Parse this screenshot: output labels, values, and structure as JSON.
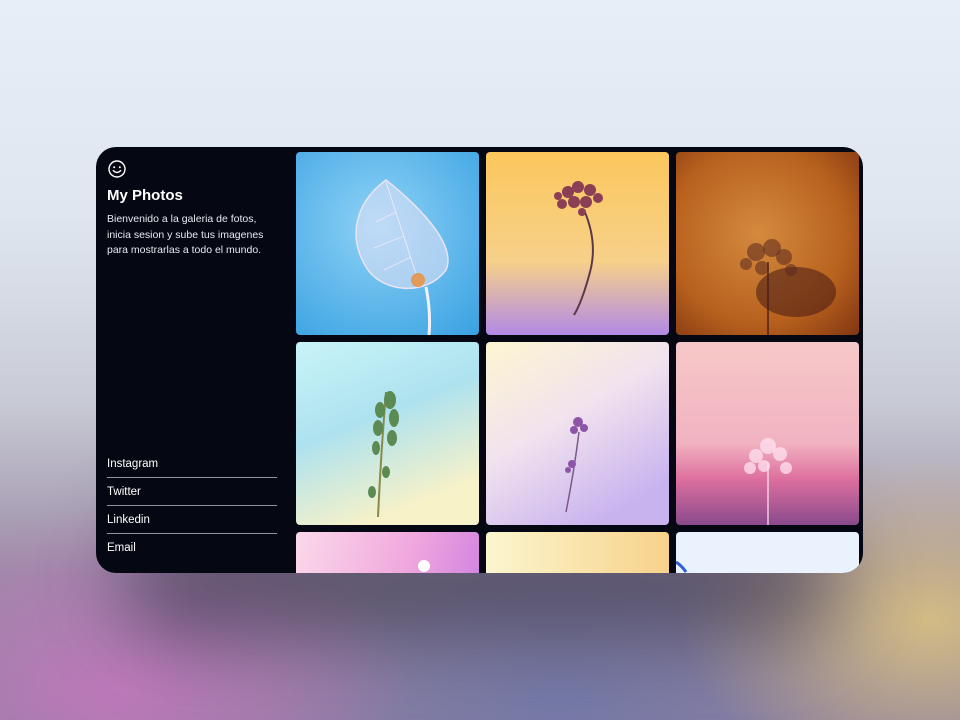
{
  "profile": {
    "title": "My Photos",
    "description": "Bienvenido a la galeria de fotos, inicia sesion y sube tus imagenes para mostrarlas a todo el mundo.",
    "logo_icon": "smiley-face-icon"
  },
  "links": [
    {
      "label": "Instagram"
    },
    {
      "label": "Twitter"
    },
    {
      "label": "Linkedin"
    },
    {
      "label": "Email"
    }
  ],
  "photos": [
    {
      "subject": "skeleton leaf on blue background"
    },
    {
      "subject": "dried fern sprig on yellow-violet gradient"
    },
    {
      "subject": "fern silhouette on orange background"
    },
    {
      "subject": "green herb sprig on cyan-yellow gradient"
    },
    {
      "subject": "purple wildflower on cream-lavender gradient"
    },
    {
      "subject": "white fern on pink-magenta gradient"
    },
    {
      "subject": "white flower on pink-violet gradient"
    },
    {
      "subject": "pale yellow gradient"
    },
    {
      "subject": "light blue background"
    }
  ],
  "colors": {
    "window_bg": "#050812",
    "text": "#ffffff",
    "divider": "#8e93a0"
  }
}
